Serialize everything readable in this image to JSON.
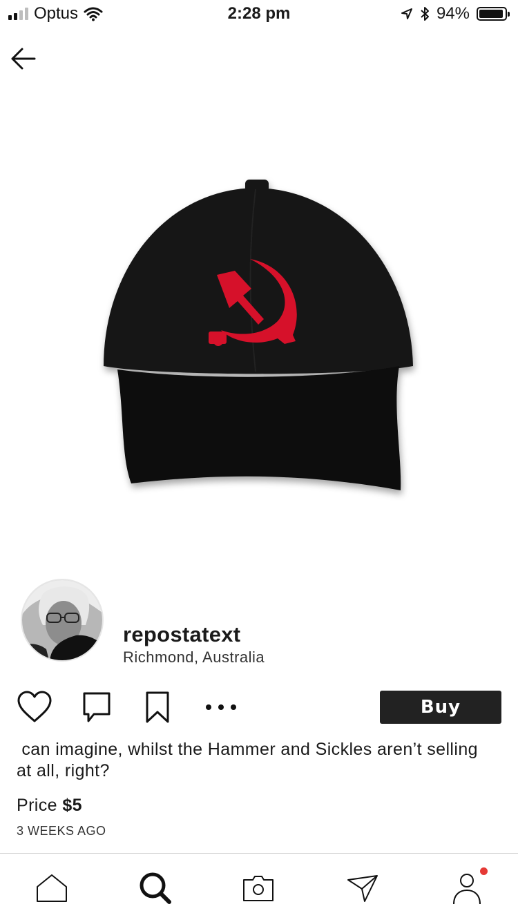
{
  "status_bar": {
    "carrier": "Optus",
    "time": "2:28 pm",
    "battery": "94%",
    "battery_level": 0.94
  },
  "header": {
    "back_icon": "arrow-left-icon"
  },
  "product": {
    "image": "black-cap-with-red-hammer-and-sickle",
    "colors": {
      "cap": "#141414",
      "emblem": "#d6112a"
    }
  },
  "seller": {
    "username": "repostatext",
    "location": "Richmond, Australia",
    "avatar": "user-avatar-photo"
  },
  "actions": {
    "icons": [
      "heart-icon",
      "comment-icon",
      "bookmark-icon",
      "more-icon"
    ],
    "buy_label": "Buy"
  },
  "post": {
    "description": " can imagine, whilst the Hammer and Sickles aren’t selling at all, right?",
    "price_label": "Price",
    "price_value": "$5",
    "timestamp": "3 WEEKS AGO"
  },
  "bottom_nav": {
    "items": [
      "home-icon",
      "search-icon",
      "camera-icon",
      "send-icon",
      "profile-icon"
    ],
    "notification_color": "#e53935"
  }
}
